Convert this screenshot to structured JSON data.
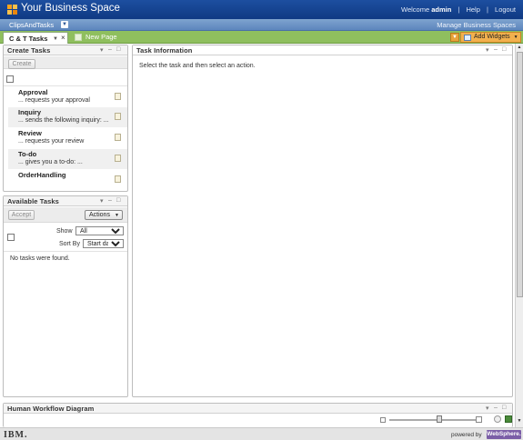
{
  "header": {
    "app_title": "Your Business Space",
    "welcome_prefix": "Welcome",
    "user": "admin",
    "help": "Help",
    "logout": "Logout",
    "separator": "|"
  },
  "spacebar": {
    "space_name": "ClipsAndTasks",
    "manage_link": "Manage Business Spaces"
  },
  "tabs": {
    "active_label": "C & T Tasks",
    "close_symbol": "×",
    "new_page": "New Page",
    "add_widgets": "Add Widgets"
  },
  "create_tasks": {
    "title": "Create Tasks",
    "create_button": "Create",
    "tasks": [
      {
        "name": "Approval",
        "desc": "... requests your approval"
      },
      {
        "name": "Inquiry",
        "desc": "... sends the following inquiry: ..."
      },
      {
        "name": "Review",
        "desc": "... requests your review"
      },
      {
        "name": "To-do",
        "desc": "... gives you a to-do: ..."
      },
      {
        "name": "OrderHandling",
        "desc": ""
      }
    ]
  },
  "available_tasks": {
    "title": "Available Tasks",
    "accept_button": "Accept",
    "actions_button": "Actions",
    "show_label": "Show",
    "show_value": "All",
    "sortby_label": "Sort By",
    "sortby_value": "Start date",
    "empty_message": "No tasks were found."
  },
  "task_information": {
    "title": "Task Information",
    "message": "Select the task and then select an action."
  },
  "workflow": {
    "title": "Human Workflow Diagram"
  },
  "footer": {
    "ibm": "IBM.",
    "powered_by": "powered by",
    "websphere": "WebSphere."
  },
  "icons": {
    "logo": "business-space-logo-icon",
    "chevron": "chevron-down-icon",
    "close": "close-icon",
    "minimize": "minimize-icon",
    "maximize": "maximize-icon",
    "task": "task-template-icon",
    "zoom": "zoom-slider-icon"
  },
  "colors": {
    "banner": "#1d4fa0",
    "spacebar": "#6b92c6",
    "tabbar": "#8fbf5e",
    "add_widgets": "#f2b04d",
    "websphere": "#7b5ea7"
  }
}
